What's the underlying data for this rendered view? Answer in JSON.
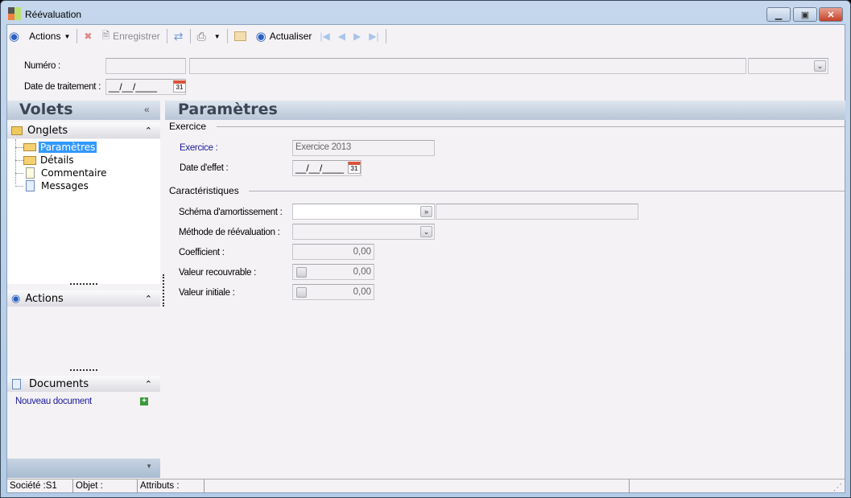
{
  "window": {
    "title": "Réévaluation"
  },
  "toolbar": {
    "actions": "Actions",
    "save": "Enregistrer",
    "refresh": "Actualiser"
  },
  "header": {
    "numero_label": "Numéro :",
    "date_label": "Date de traitement :",
    "date_value": "__/__/____",
    "cal": "31"
  },
  "sidebar": {
    "title": "Volets",
    "onglets": "Onglets",
    "tree": [
      "Paramètres",
      "Détails",
      "Commentaire",
      "Messages"
    ],
    "actions": "Actions",
    "documents": "Documents",
    "new_doc": "Nouveau document"
  },
  "main": {
    "title": "Paramètres",
    "group1": "Exercice",
    "exercice_label": "Exercice :",
    "exercice_value": "Exercice 2013",
    "date_effet_label": "Date d'effet :",
    "date_effet_value": "__/__/____",
    "group2": "Caractéristiques",
    "schema_label": "Schéma d'amortissement :",
    "methode_label": "Méthode de réévaluation :",
    "coef_label": "Coefficient :",
    "coef_value": "0,00",
    "valrec_label": "Valeur recouvrable :",
    "valrec_value": "0,00",
    "valinit_label": "Valeur initiale :",
    "valinit_value": "0,00"
  },
  "status": {
    "societe": "Société :S1",
    "objet": "Objet :",
    "attributs": "Attributs :"
  }
}
